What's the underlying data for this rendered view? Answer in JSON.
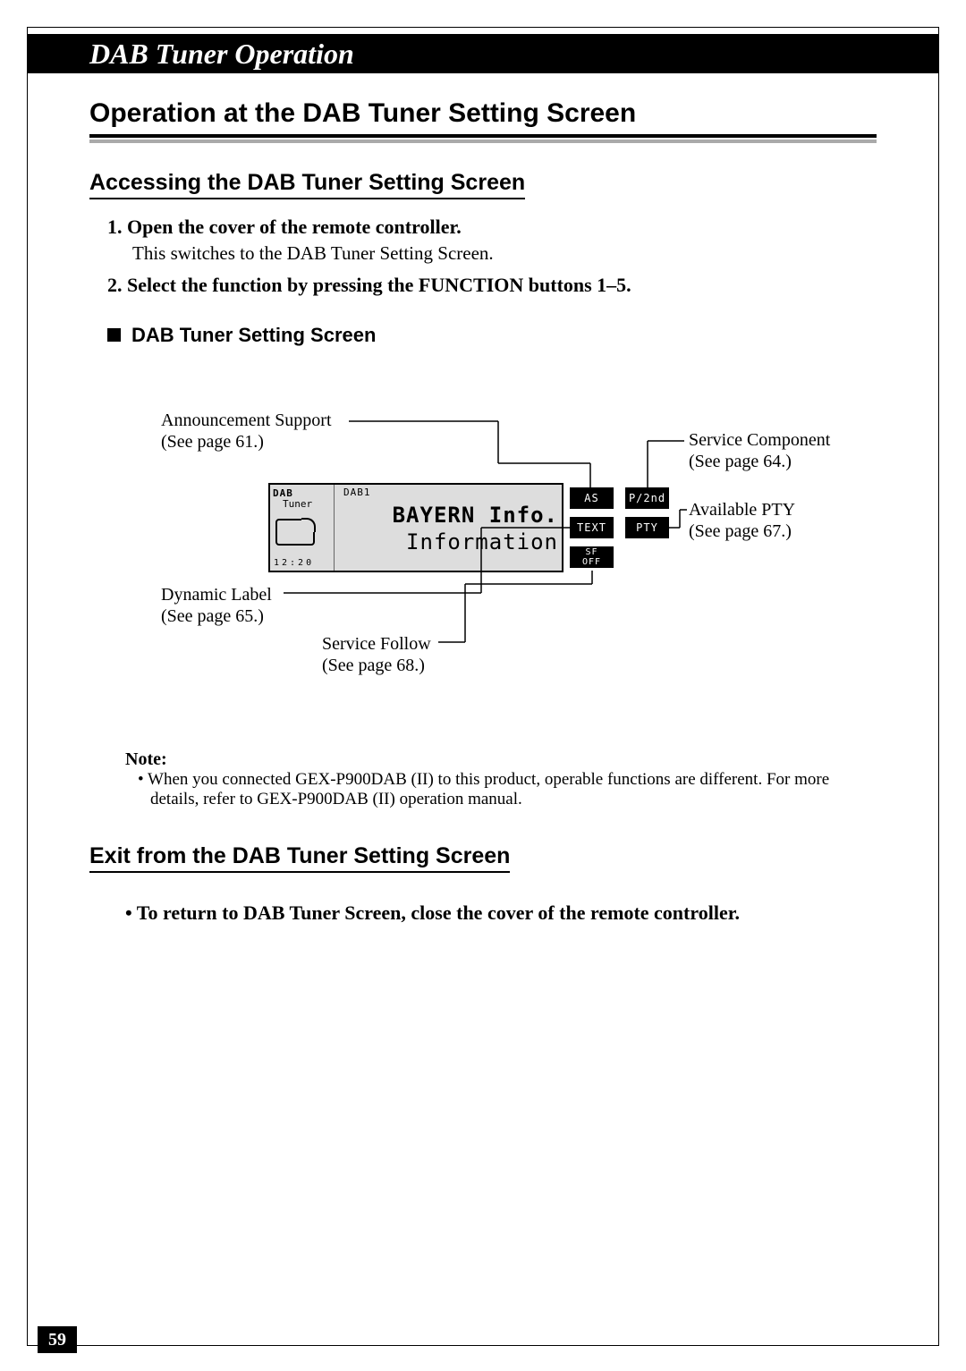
{
  "header": "DAB Tuner Operation",
  "title": "Operation at the DAB Tuner Setting Screen",
  "section1": {
    "heading": "Accessing the DAB Tuner Setting Screen",
    "step1_label": "1.  Open the cover of the remote controller.",
    "step1_body": "This switches to the DAB Tuner Setting Screen.",
    "step2_label": "2.  Select the function by pressing the FUNCTION buttons 1–5.",
    "sub_heading": "DAB Tuner Setting Screen"
  },
  "diagram": {
    "callouts": {
      "announcement": "Announcement Support",
      "announcement_ref": "(See page 61.)",
      "dynamic": "Dynamic Label",
      "dynamic_ref": "(See page 65.)",
      "service_follow": "Service Follow",
      "service_follow_ref": "(See page 68.)",
      "service_component": "Service Component",
      "service_component_ref": "(See page 64.)",
      "available_pty": "Available PTY",
      "available_pty_ref": "(See page 67.)"
    },
    "device": {
      "dab": "DAB",
      "tuner": "Tuner",
      "clock": "12:20",
      "dab1": "DAB1",
      "line1": "BAYERN Info.",
      "line2": "Information"
    },
    "buttons": {
      "as": "AS",
      "p2nd": "P/2nd",
      "text": "TEXT",
      "pty": "PTY",
      "sf": "SF",
      "off": "OFF"
    }
  },
  "note": {
    "title": "Note:",
    "body": "•  When you connected GEX-P900DAB (II) to this product, operable functions are different. For more details, refer to GEX-P900DAB (II) operation manual."
  },
  "section2": {
    "heading": "Exit from the DAB Tuner Setting Screen",
    "bullet": "• To return to DAB Tuner Screen, close the cover of the remote controller."
  },
  "page_number": "59"
}
